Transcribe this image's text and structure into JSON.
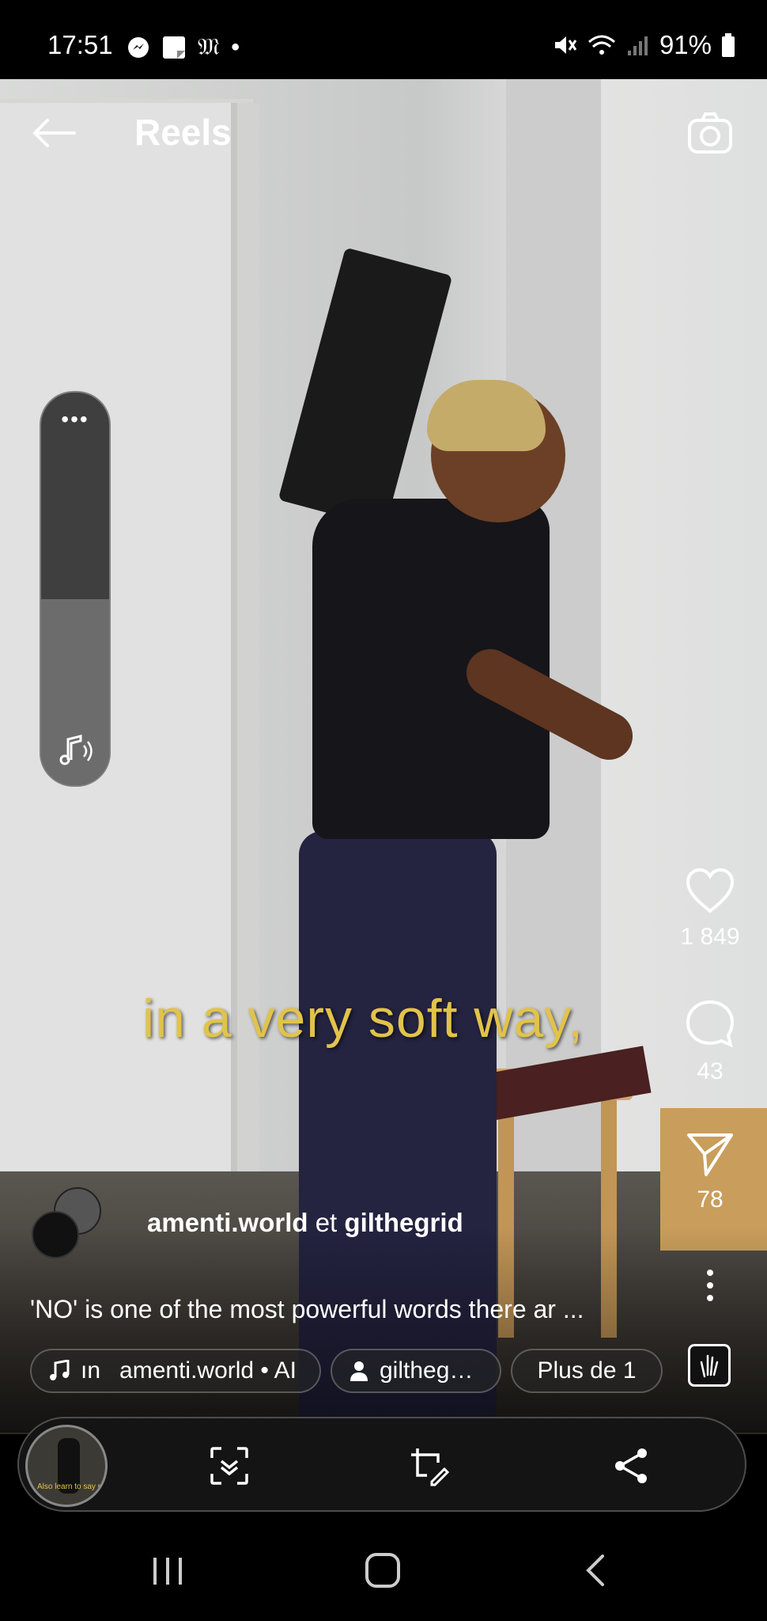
{
  "status_bar": {
    "time": "17:51",
    "battery": "91%"
  },
  "header": {
    "title": "Reels"
  },
  "video": {
    "caption": "in a very soft way,"
  },
  "actions": {
    "likes": "1 849",
    "comments": "43",
    "shares": "78"
  },
  "post": {
    "author1": "amenti.world",
    "conjunction": "et",
    "author2": "gilthegrid",
    "description": "'NO' is one of the most powerful words there ar ...",
    "audio_prefix": "ın",
    "audio_label": "amenti.world • AI",
    "tag_label": "giltheg…",
    "more_label": "Plus de 1"
  },
  "thumbnail": {
    "caption": "Also learn to say no"
  },
  "colors": {
    "caption": "#e2c34a",
    "bar": "#141414"
  }
}
